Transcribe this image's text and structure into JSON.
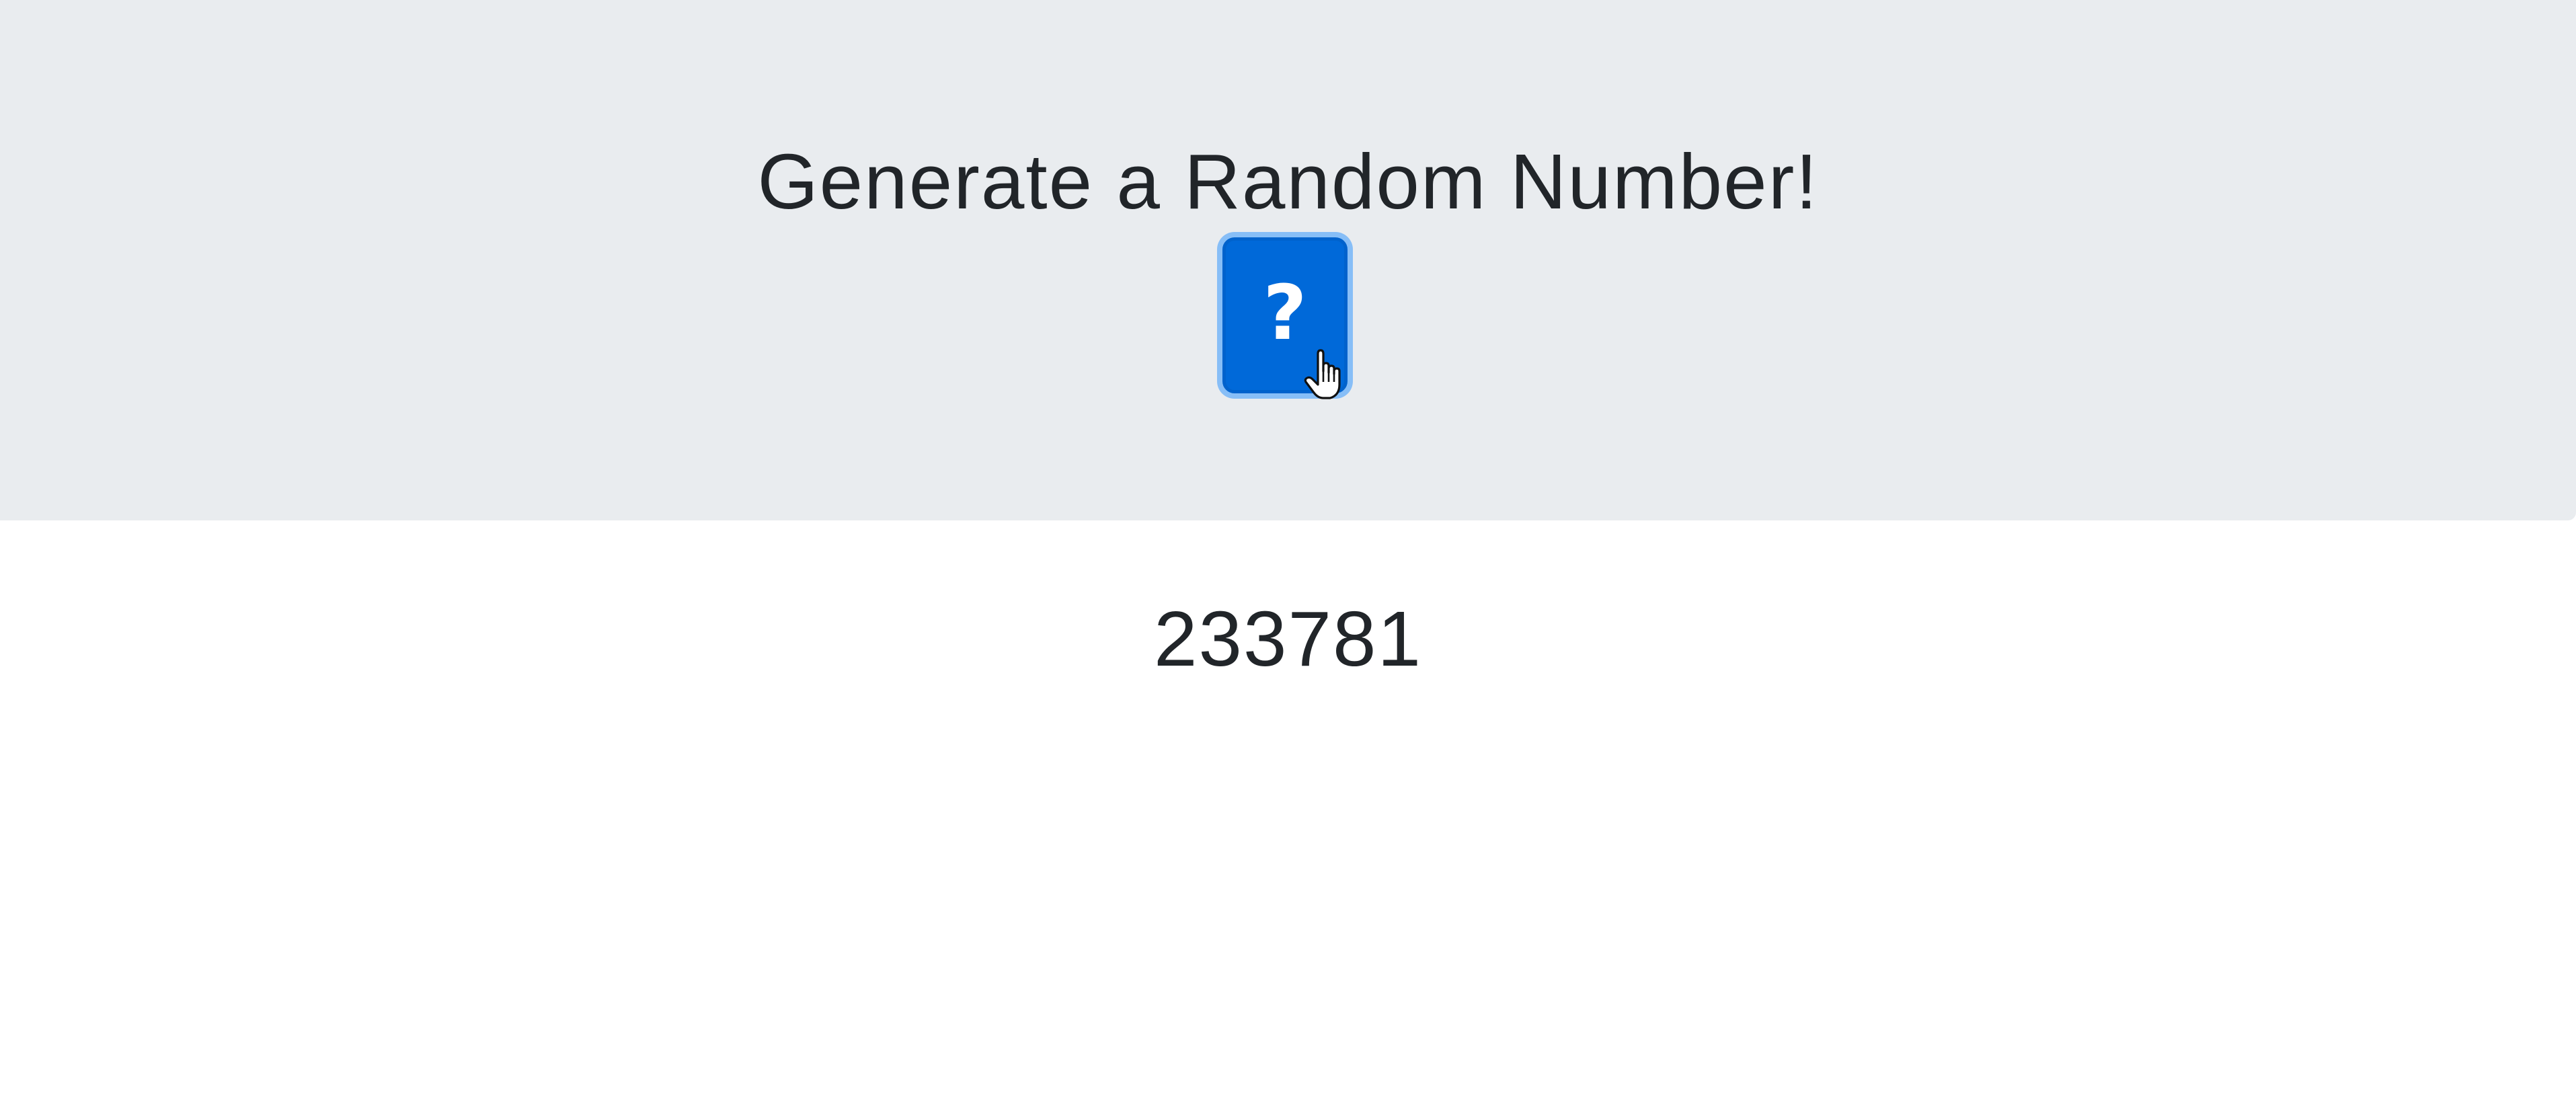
{
  "header": {
    "title": "Generate a Random Number!"
  },
  "generate_button": {
    "icon": "question-icon",
    "glyph": "?",
    "color": "#0069d9"
  },
  "result": {
    "value": "233781"
  },
  "colors": {
    "jumbotron_bg": "#e9ecef",
    "text": "#212529",
    "button": "#0069d9"
  }
}
